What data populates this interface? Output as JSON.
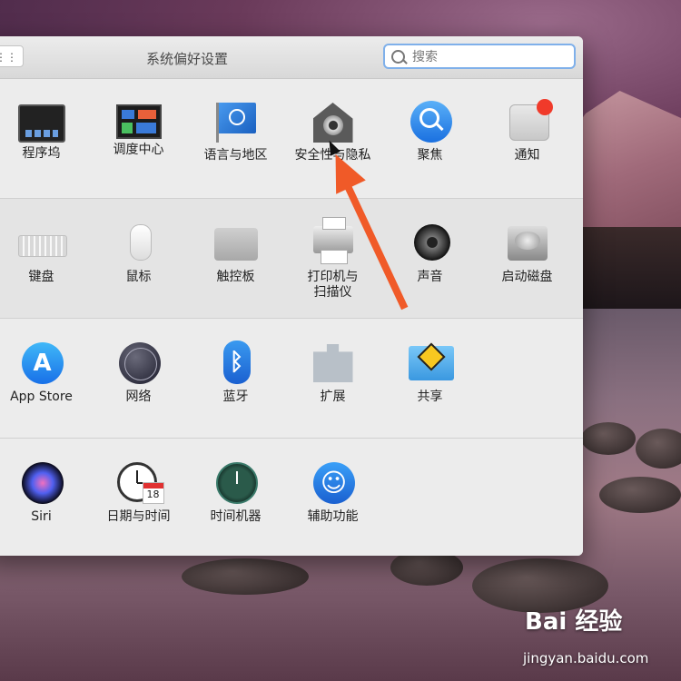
{
  "window": {
    "title": "系统偏好设置",
    "search_placeholder": "搜索"
  },
  "rows": [
    [
      {
        "label": "程序坞",
        "icon": "dock-icon"
      },
      {
        "label": "调度中心",
        "icon": "mission-control-icon"
      },
      {
        "label": "语言与地区",
        "icon": "language-region-icon"
      },
      {
        "label": "安全性与隐私",
        "icon": "security-privacy-icon"
      },
      {
        "label": "聚焦",
        "icon": "spotlight-icon"
      },
      {
        "label": "通知",
        "icon": "notifications-icon"
      }
    ],
    [
      {
        "label": "键盘",
        "icon": "keyboard-icon"
      },
      {
        "label": "鼠标",
        "icon": "mouse-icon"
      },
      {
        "label": "触控板",
        "icon": "trackpad-icon"
      },
      {
        "label": "打印机与\n扫描仪",
        "icon": "printer-icon"
      },
      {
        "label": "声音",
        "icon": "sound-icon"
      },
      {
        "label": "启动磁盘",
        "icon": "startup-disk-icon"
      }
    ],
    [
      {
        "label": "App Store",
        "icon": "app-store-icon"
      },
      {
        "label": "网络",
        "icon": "network-icon"
      },
      {
        "label": "蓝牙",
        "icon": "bluetooth-icon"
      },
      {
        "label": "扩展",
        "icon": "extensions-icon"
      },
      {
        "label": "共享",
        "icon": "sharing-icon"
      }
    ],
    [
      {
        "label": "Siri",
        "icon": "siri-icon"
      },
      {
        "label": "日期与时间",
        "icon": "date-time-icon"
      },
      {
        "label": "时间机器",
        "icon": "time-machine-icon"
      },
      {
        "label": "辅助功能",
        "icon": "accessibility-icon"
      }
    ]
  ],
  "calendar_day": "18",
  "watermark": {
    "logo": "Bai 经验",
    "url": "jingyan.baidu.com"
  },
  "colors": {
    "annotation_arrow": "#f05a28",
    "search_focus": "#7fb0ea"
  }
}
